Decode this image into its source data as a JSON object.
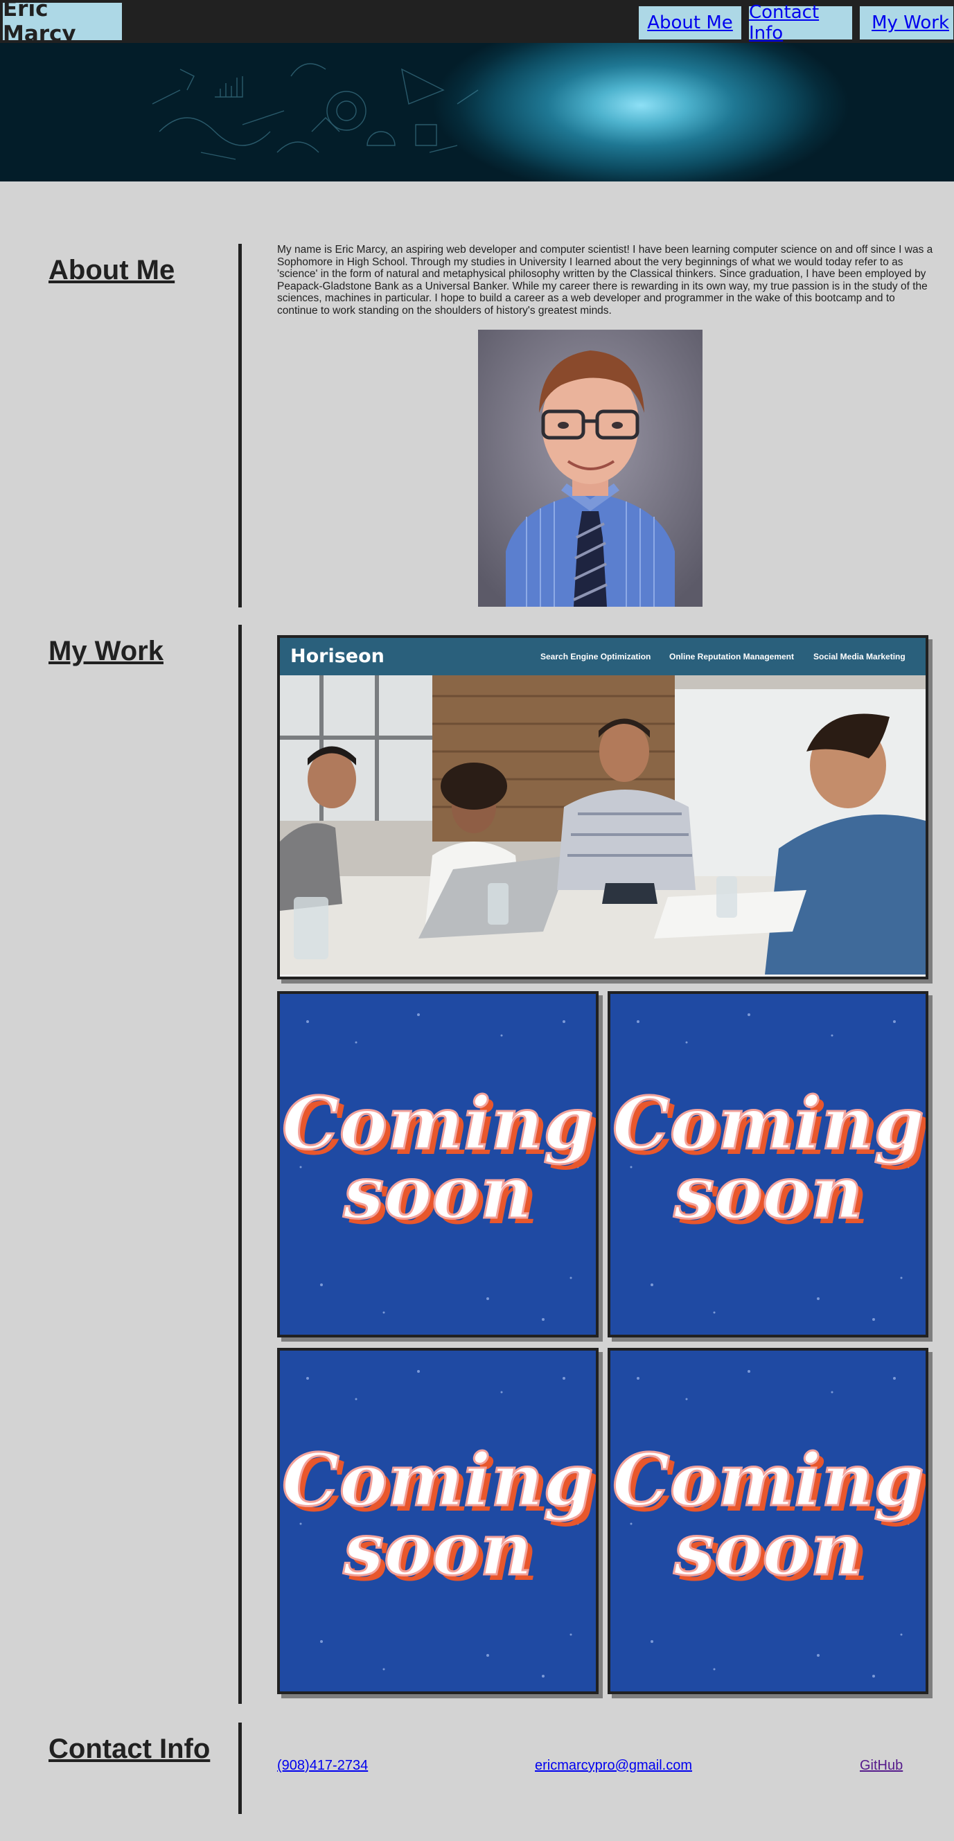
{
  "header": {
    "brand": "Eric Marcy",
    "nav": [
      {
        "label": "About Me"
      },
      {
        "label": "Contact Info"
      },
      {
        "label": "My Work"
      }
    ]
  },
  "about": {
    "title": "About Me",
    "text": "My name is Eric Marcy, an aspiring web developer and computer scientist! I have been learning computer science on and off since I was a Sophomore in High School. Through my studies in University I learned about the very beginnings of what we would today refer to as 'science' in the form of natural and metaphysical philosophy written by the Classical thinkers. Since graduation, I have been employed by Peapack-Gladstone Bank as a Universal Banker. While my career there is rewarding in its own way, my true passion is in the study of the sciences, machines in particular. I hope to build a career as a web developer and programmer in the wake of this bootcamp and to continue to work standing on the shoulders of history's greatest minds."
  },
  "work": {
    "title": "My Work",
    "featured": {
      "brand": "Horiseon",
      "nav": [
        "Search Engine Optimization",
        "Online Reputation Management",
        "Social Media Marketing"
      ]
    },
    "placeholders": [
      {
        "line1": "Coming",
        "line2": "soon"
      },
      {
        "line1": "Coming",
        "line2": "soon"
      },
      {
        "line1": "Coming",
        "line2": "soon"
      },
      {
        "line1": "Coming",
        "line2": "soon"
      }
    ]
  },
  "contact": {
    "title": "Contact Info",
    "phone": "(908)417-2734",
    "email": "ericmarcypro@gmail.com",
    "github": "GitHub"
  },
  "colors": {
    "nav_bg": "#212121",
    "nav_button": "#add8e6",
    "page_bg": "#d3d3d3",
    "link": "#0000ee",
    "visited_link": "#551a8b",
    "coming_soon_bg": "#1f4aa3"
  }
}
